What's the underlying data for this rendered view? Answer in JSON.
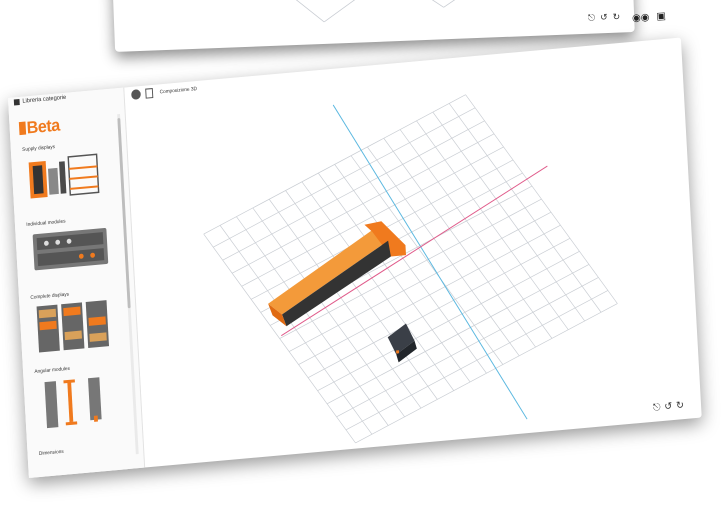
{
  "sidebar": {
    "header": "Libreria categorie",
    "brand": "Beta",
    "categories": [
      "Supply displays",
      "Individual modules",
      "Complete displays",
      "Angular modules",
      "Dimensions"
    ]
  },
  "toolbar": {
    "title": "Composizione 3D"
  },
  "controls": {
    "back": [
      "⎋",
      "↺",
      "↻"
    ],
    "main": [
      "⎋",
      "↺",
      "↻"
    ]
  },
  "colors": {
    "accent": "#f07a1e",
    "grid": "#c9cdd3",
    "axis_x": "#e05a8a",
    "axis_y": "#5bb8e0"
  }
}
